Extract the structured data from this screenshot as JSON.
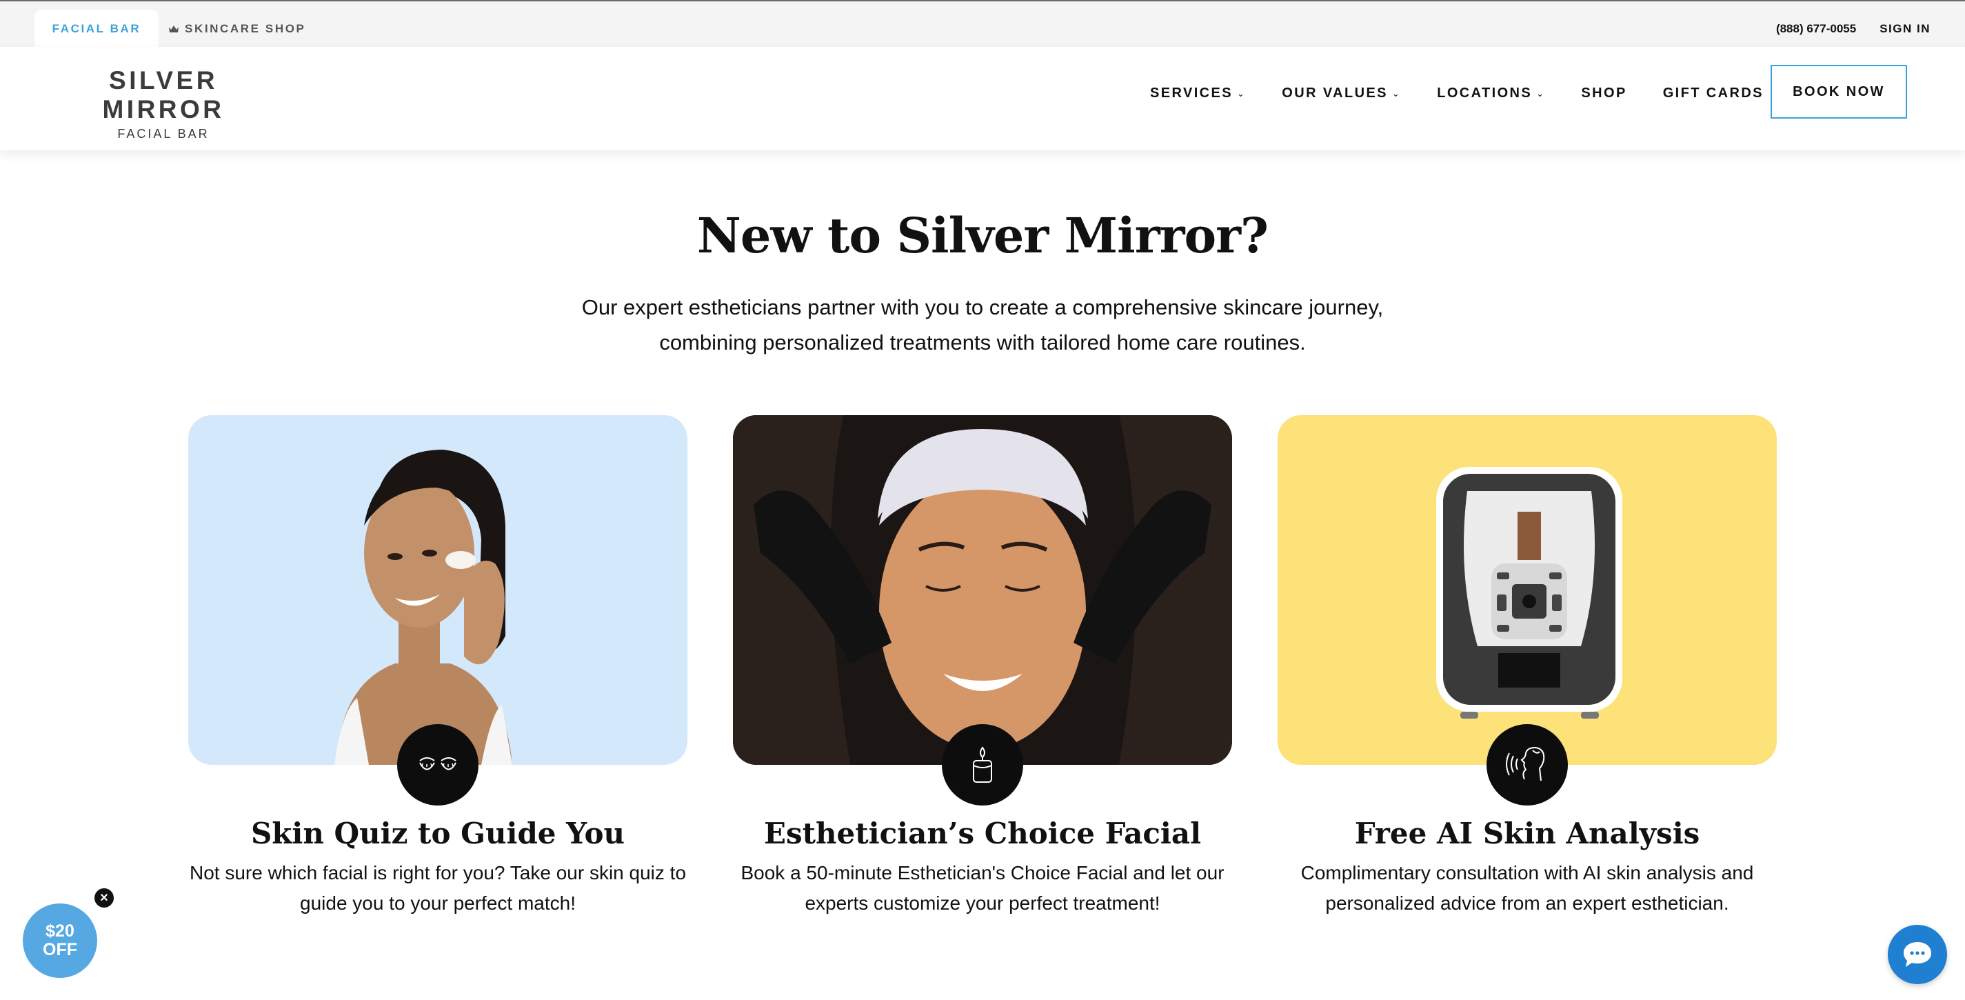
{
  "topbar": {
    "tab_facial_bar": "FACIAL BAR",
    "tab_skincare_shop": "SKINCARE SHOP",
    "phone": "(888) 677-0055",
    "sign_in": "SIGN IN"
  },
  "header": {
    "logo_main": "SILVER MIRROR",
    "logo_sub": "FACIAL BAR",
    "nav": {
      "services": "SERVICES",
      "our_values": "OUR VALUES",
      "locations": "LOCATIONS",
      "shop": "SHOP",
      "gift_cards": "GIFT CARDS"
    },
    "book_now": "BOOK NOW"
  },
  "hero": {
    "title": "New to Silver Mirror?",
    "description": "Our expert estheticians partner with you to create a comprehensive skincare journey, combining personalized treatments with tailored home care routines."
  },
  "cards": [
    {
      "title": "Skin Quiz to Guide You",
      "description": "Not sure which facial is right for you? Take our skin quiz to guide you to your perfect match!",
      "icon": "eye-patches-icon"
    },
    {
      "title": "Esthetician’s Choice Facial",
      "description": "Book a 50-minute Esthetician's Choice Facial and let our experts customize your perfect treatment!",
      "icon": "candle-icon"
    },
    {
      "title": "Free AI Skin Analysis",
      "description": "Complimentary consultation with AI skin analysis and personalized advice from an expert esthetician.",
      "icon": "face-scan-icon"
    }
  ],
  "promo": {
    "amount": "$20",
    "label": "OFF"
  },
  "colors": {
    "accent": "#3aa0de",
    "card1_bg": "#d4e8fb",
    "card3_bg": "#fde27a",
    "badge": "#0d0d0d",
    "promo": "#56a8e3",
    "chat": "#1f7fd0"
  }
}
